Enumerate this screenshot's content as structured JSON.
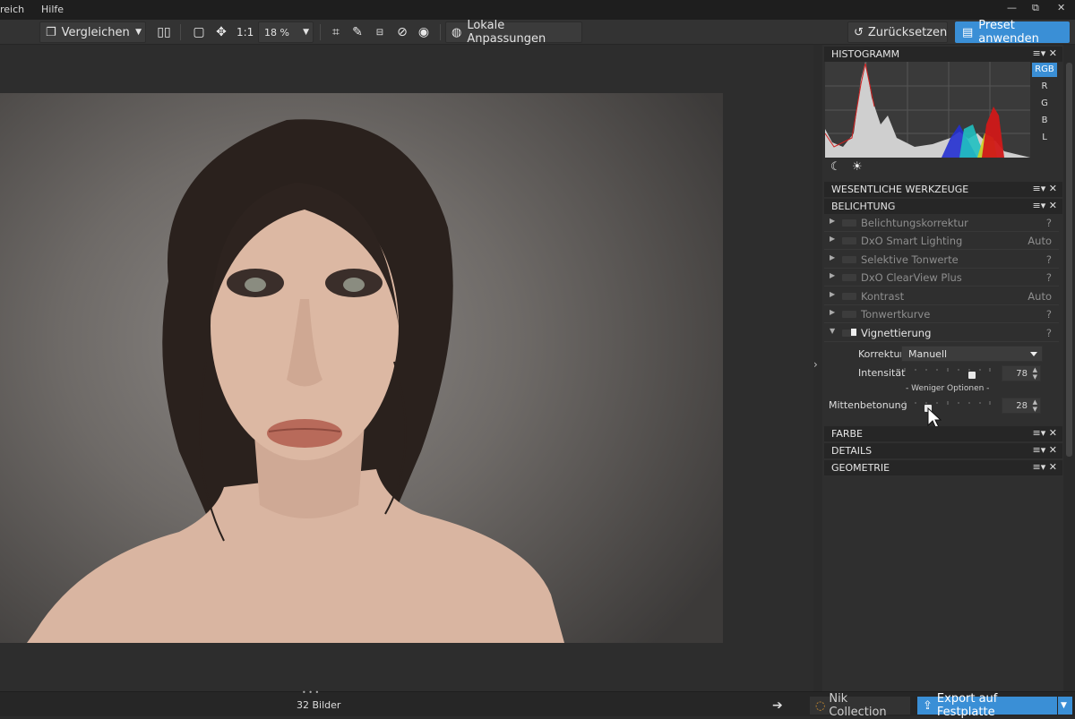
{
  "menu": {
    "items": [
      "reich",
      "Hilfe"
    ]
  },
  "window": {
    "minimize": "—",
    "restore": "⧉",
    "close": "✕"
  },
  "toolbar": {
    "compare_label": "Vergleichen",
    "zoom_one_label": "1:1",
    "zoom_value": "18 %",
    "local_adjust_label": "Lokale Anpassungen",
    "reset_label": "Zurücksetzen",
    "preset_label": "Preset anwenden"
  },
  "panel": {
    "histogram_title": "HISTOGRAMM",
    "channels": [
      "RGB",
      "R",
      "G",
      "B",
      "L"
    ],
    "essential_title": "WESENTLICHE WERKZEUGE",
    "exposure_title": "BELICHTUNG",
    "tools": [
      {
        "label": "Belichtungskorrektur",
        "right": "?"
      },
      {
        "label": "DxO Smart Lighting",
        "right": "Auto"
      },
      {
        "label": "Selektive Tonwerte",
        "right": "?"
      },
      {
        "label": "DxO ClearView Plus",
        "right": "?"
      },
      {
        "label": "Kontrast",
        "right": "Auto"
      },
      {
        "label": "Tonwertkurve",
        "right": "?"
      },
      {
        "label": "Vignettierung",
        "right": "?"
      }
    ],
    "vignette": {
      "korrektur_label": "Korrektur",
      "korrektur_value": "Manuell",
      "intensitaet_label": "Intensität",
      "intensitaet_value": "78",
      "intensitaet_fraction": 0.78,
      "fewer_options": "- Weniger Optionen -",
      "mitten_label": "Mittenbetonung",
      "mitten_value": "28",
      "mitten_fraction": 0.28
    },
    "farbe_title": "FARBE",
    "details_title": "DETAILS",
    "geometrie_title": "GEOMETRIE"
  },
  "status": {
    "dots": "• • •",
    "image_count": "32 Bilder",
    "nik_label": "Nik Collection",
    "export_label": "Export auf Festplatte"
  }
}
